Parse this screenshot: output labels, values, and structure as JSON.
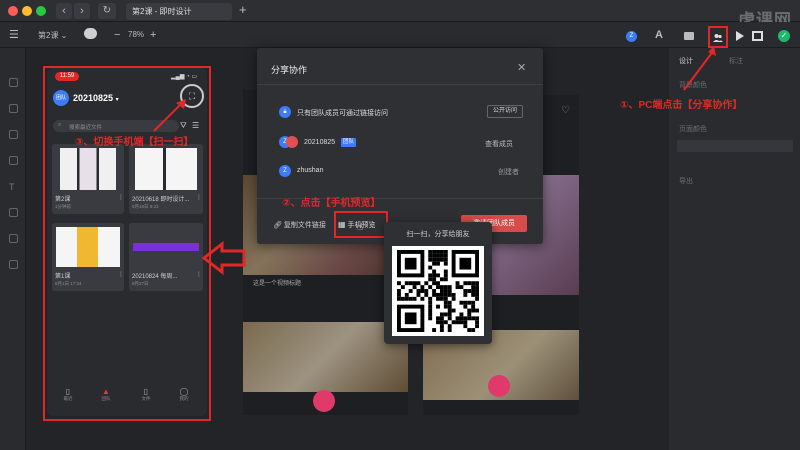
{
  "window": {
    "tab_title": "第2课 - 即时设计",
    "new_tab": "+",
    "watermark": "虎课网"
  },
  "toolbar": {
    "project_label": "第2课 ⌄",
    "zoom": "78%",
    "zoom_out": "−",
    "zoom_in": "+",
    "avatar_letter": "Z"
  },
  "phone": {
    "time": "11:59",
    "team_badge": "团队",
    "team_name": "20210825",
    "search_placeholder": "搜索最近文件",
    "files": [
      {
        "name": "第2课",
        "sub": "1分钟前"
      },
      {
        "name": "20210618 即时设计...",
        "sub": "6月18日 9:23"
      },
      {
        "name": "第1课",
        "sub": "8月1日 17:24"
      },
      {
        "name": "20210824 每周...",
        "sub": "8月27日"
      }
    ],
    "nav": [
      "最近",
      "团队",
      "文件",
      "我的"
    ]
  },
  "mock": {
    "left_title": "这是一个视频标题"
  },
  "modal": {
    "title": "分享协作",
    "access_text": "只有团队成员可通过链接访问",
    "public_btn": "公开访问",
    "team_letter": "Z",
    "team_name": "20210825",
    "team_badge": "团队",
    "view_members": "查看成员",
    "user_letter": "Z",
    "user_name": "zhushan",
    "role": "创建者",
    "copy_link": "复制文件链接",
    "phone_preview": "手机预览",
    "invite_btn": "邀请团队成员"
  },
  "qr": {
    "caption": "扫一扫，分享给朋友"
  },
  "annotations": {
    "step1": "①、PC端点击【分享协作】",
    "step2": "②、点击【手机预览】",
    "step3": "③、切换手机端【扫一扫】"
  },
  "right_panel": {
    "tabs": [
      "设计",
      "标注"
    ],
    "bg_label": "背景颜色",
    "section2": "页面颜色",
    "export": "导出"
  },
  "colors": {
    "accent_red": "#e02828",
    "blue": "#3d7bf7",
    "invite": "#d94a4a"
  }
}
